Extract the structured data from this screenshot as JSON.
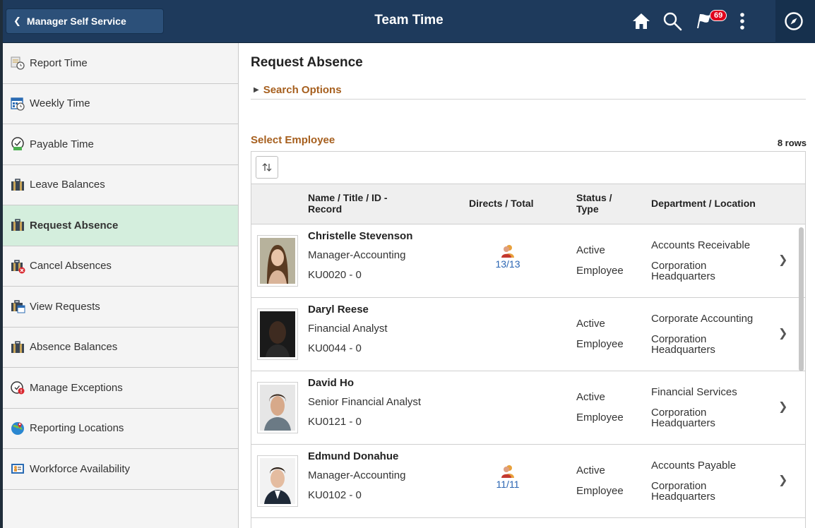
{
  "header": {
    "back_label": "Manager Self Service",
    "title": "Team Time",
    "notification_count": "69",
    "icons": [
      "home-icon",
      "search-icon",
      "notification-flag-icon",
      "more-actions-icon",
      "navbar-compass-icon"
    ],
    "colors": {
      "bar": "#1e3a5c",
      "back_button": "#2c5079",
      "badge": "#e0001b"
    }
  },
  "sidebar": {
    "items": [
      {
        "label": "Report Time",
        "icon": "report-time-icon"
      },
      {
        "label": "Weekly Time",
        "icon": "weekly-calendar-icon"
      },
      {
        "label": "Payable Time",
        "icon": "payable-time-icon"
      },
      {
        "label": "Leave Balances",
        "icon": "briefcase-icon"
      },
      {
        "label": "Request Absence",
        "icon": "briefcase-icon",
        "active": true
      },
      {
        "label": "Cancel Absences",
        "icon": "briefcase-cancel-icon"
      },
      {
        "label": "View Requests",
        "icon": "briefcase-calendar-icon"
      },
      {
        "label": "Absence Balances",
        "icon": "briefcase-icon"
      },
      {
        "label": "Manage Exceptions",
        "icon": "exceptions-clock-icon"
      },
      {
        "label": "Reporting Locations",
        "icon": "globe-pin-icon"
      },
      {
        "label": "Workforce Availability",
        "icon": "workforce-availability-icon"
      }
    ],
    "active_color": "#d4eedd"
  },
  "main": {
    "page_title": "Request Absence",
    "search_options_label": "Search Options",
    "section_title": "Select Employee",
    "rows_count": "8 rows",
    "accent_color": "#a65f1e",
    "columns": [
      "Name / Title / ID - Record",
      "Directs / Total",
      "Status / Type",
      "Department / Location"
    ],
    "employees": [
      {
        "name": "Christelle Stevenson",
        "title": "Manager-Accounting",
        "id": "KU0020 - 0",
        "directs": "13/13",
        "has_directs": true,
        "status": "Active",
        "type": "Employee",
        "department": "Accounts Receivable",
        "location": "Corporation Headquarters"
      },
      {
        "name": "Daryl Reese",
        "title": "Financial Analyst",
        "id": "KU0044 - 0",
        "directs": "",
        "has_directs": false,
        "status": "Active",
        "type": "Employee",
        "department": "Corporate Accounting",
        "location": "Corporation Headquarters"
      },
      {
        "name": "David Ho",
        "title": "Senior Financial Analyst",
        "id": "KU0121 - 0",
        "directs": "",
        "has_directs": false,
        "status": "Active",
        "type": "Employee",
        "department": "Financial Services",
        "location": "Corporation Headquarters"
      },
      {
        "name": "Edmund Donahue",
        "title": "Manager-Accounting",
        "id": "KU0102 - 0",
        "directs": "11/11",
        "has_directs": true,
        "status": "Active",
        "type": "Employee",
        "department": "Accounts Payable",
        "location": "Corporation Headquarters"
      }
    ]
  }
}
